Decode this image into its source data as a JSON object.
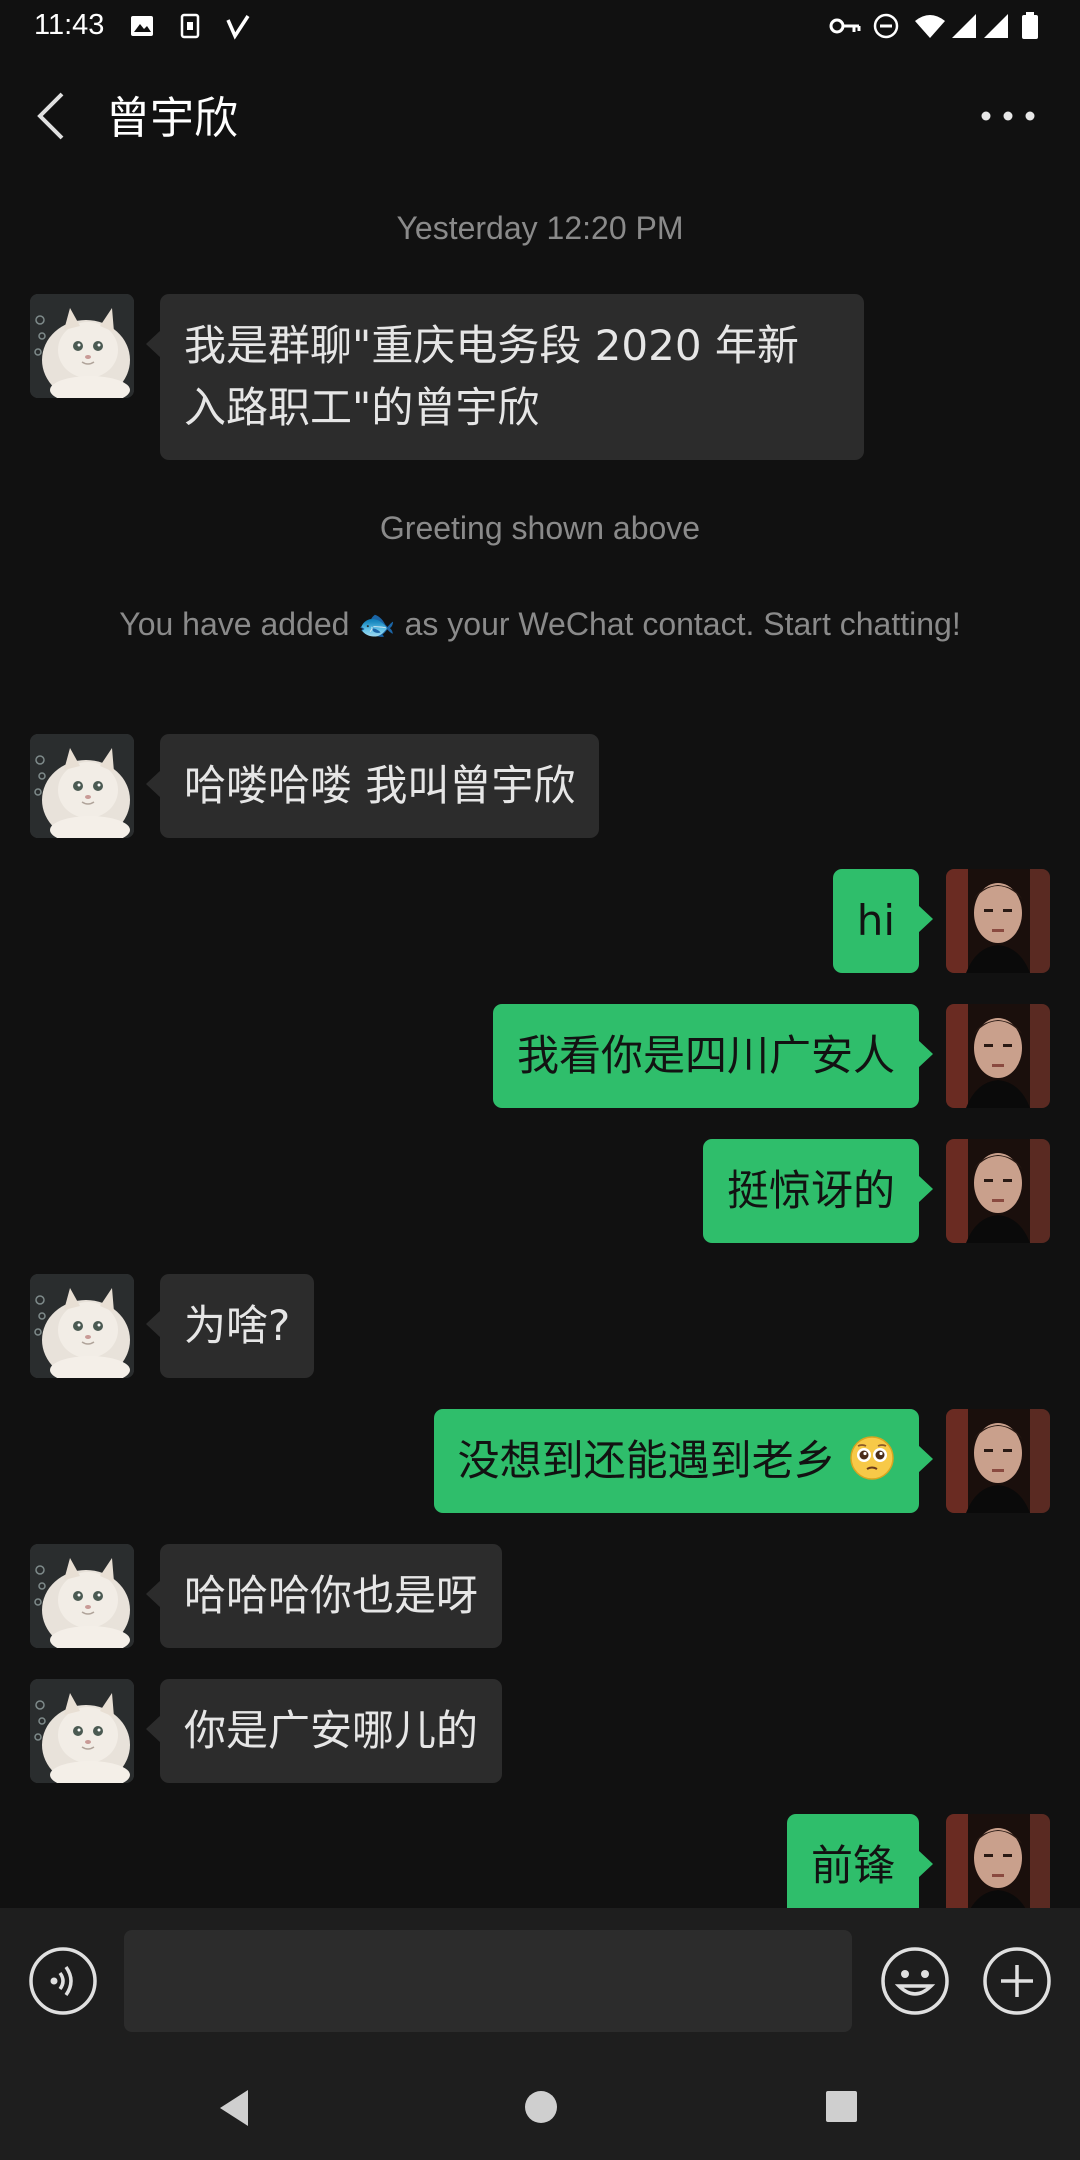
{
  "status_bar": {
    "time": "11:43",
    "icons": [
      "image-icon",
      "sim-icon",
      "check-icon",
      "vpn-key-icon",
      "dnd-icon",
      "wifi-icon",
      "signal-icon",
      "signal-icon",
      "battery-icon"
    ]
  },
  "header": {
    "title": "曾宇欣",
    "back_icon": "chevron-left-icon",
    "more_icon": "more-dots-icon"
  },
  "chat": {
    "timestamp": "Yesterday 12:20 PM",
    "greeting_text": "我是群聊\"重庆电务段 2020 年新入路职工\"的曾宇欣",
    "greeting_note": "Greeting shown above",
    "added_note_before": "You have added",
    "added_note_emoji": "🐟",
    "added_note_after": "as your WeChat contact. Start chatting!",
    "messages": [
      {
        "from": "contact",
        "text": "哈喽哈喽 我叫曾宇欣"
      },
      {
        "from": "me",
        "text": "hi"
      },
      {
        "from": "me",
        "text": "我看你是四川广安人"
      },
      {
        "from": "me",
        "text": "挺惊讶的"
      },
      {
        "from": "contact",
        "text": "为啥?"
      },
      {
        "from": "me",
        "text": "没想到还能遇到老乡",
        "emoji": "pleading-face"
      },
      {
        "from": "contact",
        "text": "哈哈哈你也是呀"
      },
      {
        "from": "contact",
        "text": "你是广安哪儿的"
      },
      {
        "from": "me",
        "text": "前锋"
      }
    ]
  },
  "input_bar": {
    "value": "",
    "icons": [
      "voice-icon",
      "emoji-icon",
      "plus-icon"
    ]
  },
  "nav_bar": {
    "icons": [
      "nav-back-icon",
      "nav-home-icon",
      "nav-recents-icon"
    ]
  },
  "colors": {
    "background": "#111111",
    "incoming_bubble": "#2c2c2c",
    "outgoing_bubble": "#2fbe6b",
    "system_text": "#8a8a8a"
  }
}
